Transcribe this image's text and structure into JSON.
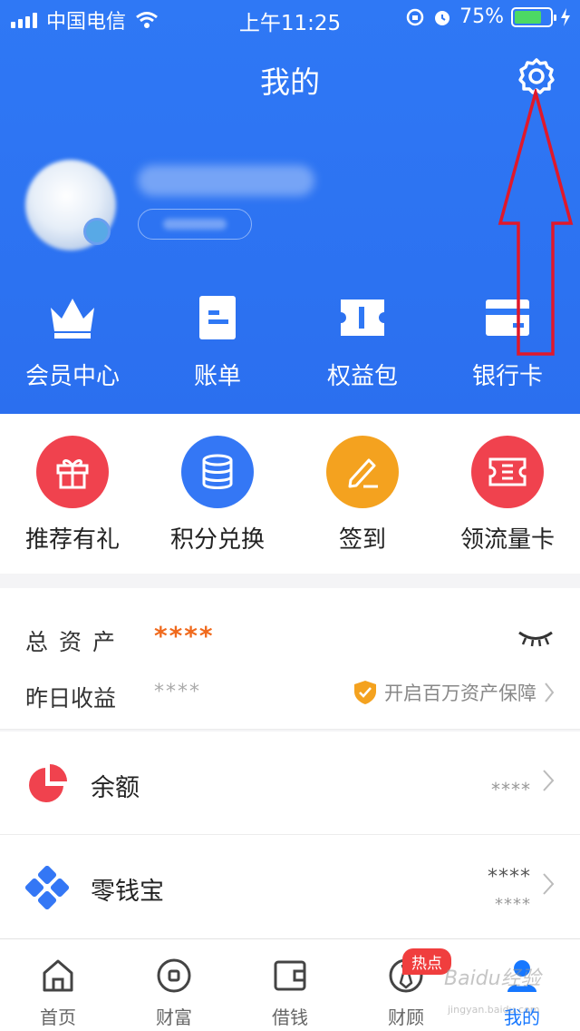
{
  "status_bar": {
    "carrier": "中国电信",
    "time": "上午11:25",
    "battery": "75%",
    "battery_level": 0.75
  },
  "header": {
    "title": "我的"
  },
  "quick_links": [
    {
      "label": "会员中心",
      "icon": "crown-icon"
    },
    {
      "label": "账单",
      "icon": "bill-icon"
    },
    {
      "label": "权益包",
      "icon": "ticket-icon"
    },
    {
      "label": "银行卡",
      "icon": "card-icon"
    }
  ],
  "services": [
    {
      "label": "推荐有礼",
      "icon": "gift-icon",
      "color": "#f0424e"
    },
    {
      "label": "积分兑换",
      "icon": "coins-icon",
      "color": "#3477f5"
    },
    {
      "label": "签到",
      "icon": "pen-icon",
      "color": "#f4a21f"
    },
    {
      "label": "领流量卡",
      "icon": "ticket-icon",
      "color": "#f0424e"
    }
  ],
  "assets": {
    "total_label": "总资产",
    "total_value": "****",
    "yesterday_label": "昨日收益",
    "yesterday_value": "****",
    "protect_text": "开启百万资产保障"
  },
  "list": [
    {
      "label": "余额",
      "value": "****",
      "icon": "pie-icon"
    },
    {
      "label": "零钱宝",
      "value": "****",
      "sub_value": "****",
      "icon": "clover-icon"
    }
  ],
  "tabs": [
    {
      "label": "首页",
      "icon": "home-icon"
    },
    {
      "label": "财富",
      "icon": "coin-icon"
    },
    {
      "label": "借钱",
      "icon": "wallet-icon"
    },
    {
      "label": "财顾",
      "icon": "tie-icon",
      "badge": "热点"
    },
    {
      "label": "我的",
      "icon": "user-icon",
      "active": true
    }
  ],
  "watermark": {
    "text": "Baidu经验",
    "url": "jingyan.baidu.com"
  },
  "colors": {
    "primary": "#2f78f5",
    "orange": "#f06a1d",
    "annotation_arrow": "#e0182a"
  }
}
